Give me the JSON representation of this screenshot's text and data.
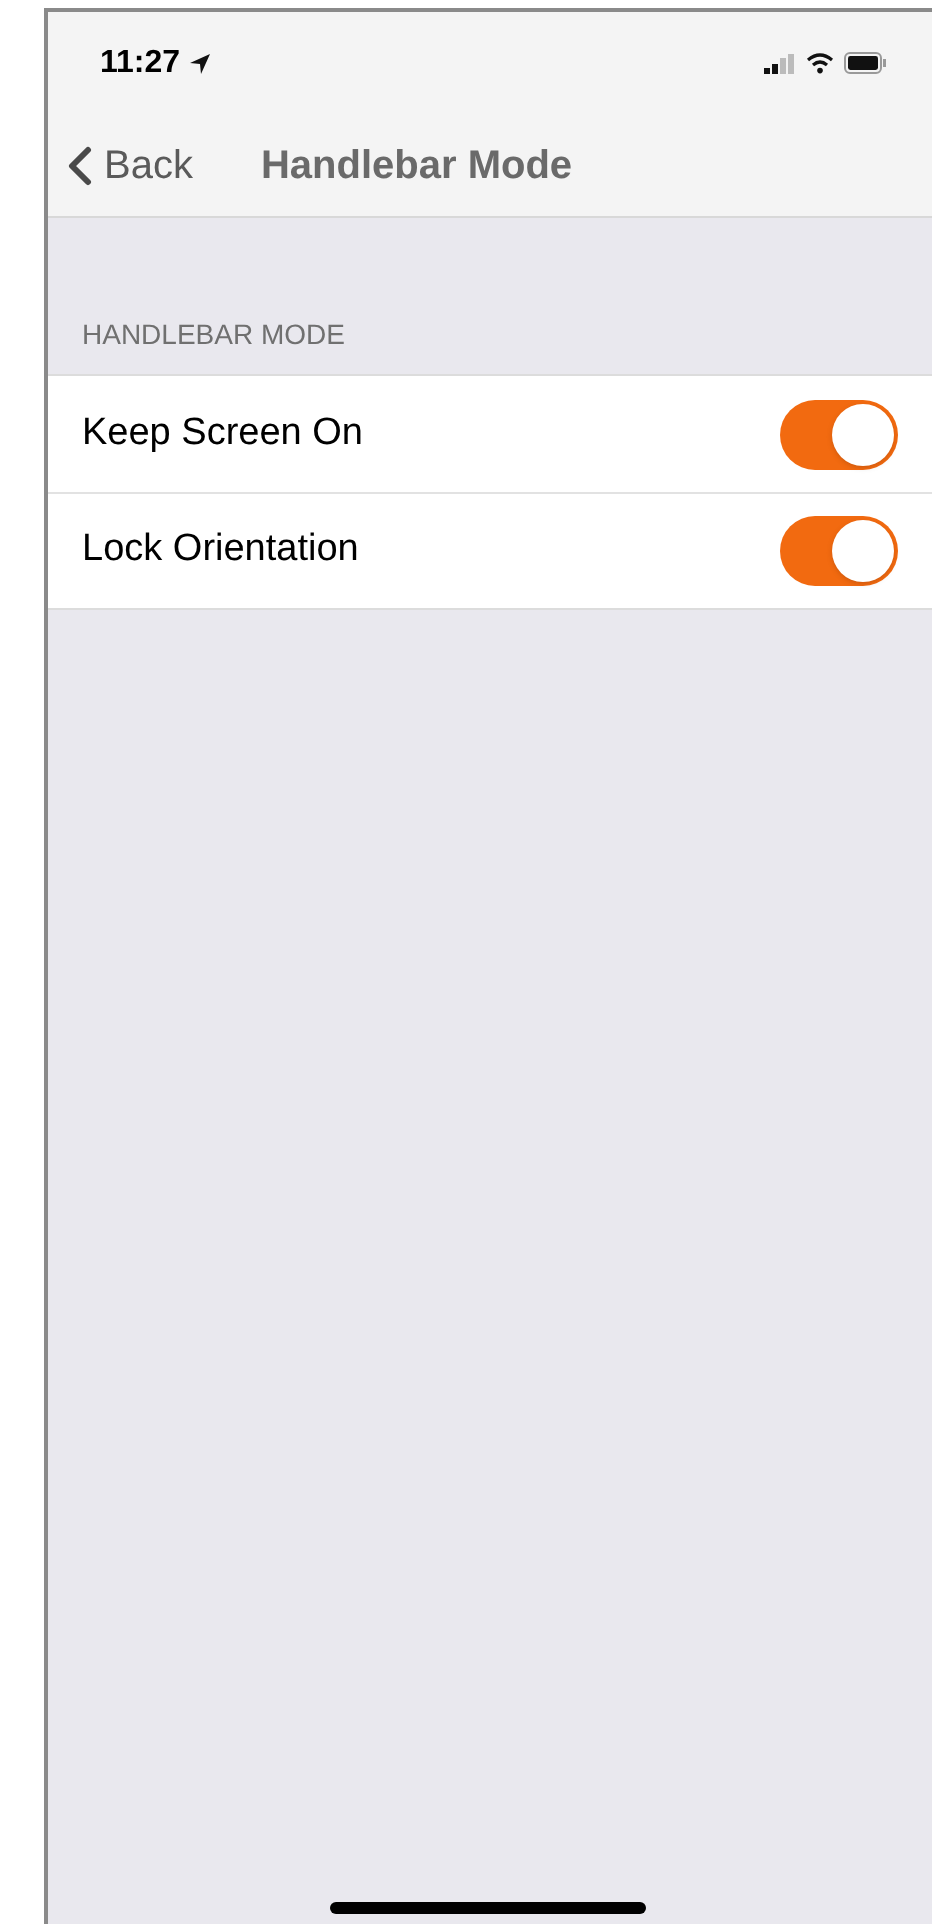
{
  "status_bar": {
    "time": "11:27"
  },
  "nav": {
    "back": "Back",
    "title": "Handlebar Mode"
  },
  "section": {
    "header": "HANDLEBAR MODE",
    "rows": [
      {
        "label": "Keep Screen On",
        "on": true
      },
      {
        "label": "Lock Orientation",
        "on": true
      }
    ]
  }
}
